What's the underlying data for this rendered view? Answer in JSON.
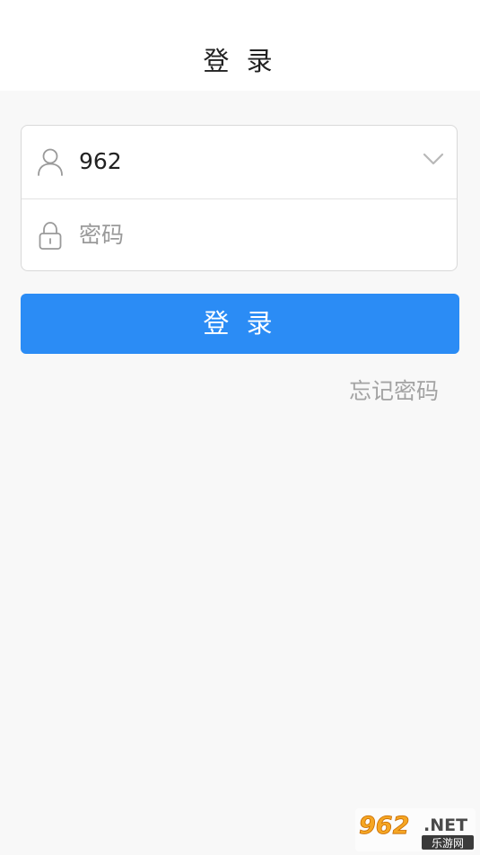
{
  "header": {
    "title": "登 录"
  },
  "login_form": {
    "account_value": "962",
    "password_placeholder": "密码",
    "account_icon": "user-icon",
    "password_icon": "lock-icon",
    "dropdown_icon": "chevron-down-icon"
  },
  "login_button_label": "登 录",
  "forgot_password_label": "忘记密码",
  "watermark": {
    "brand": "962",
    "suffix": ".NET",
    "sub_text": "乐游网"
  },
  "colors": {
    "primary": "#2b8cf5",
    "background": "#f8f8f8",
    "header_bg": "#ffffff",
    "muted_text": "#a3a3a3"
  }
}
